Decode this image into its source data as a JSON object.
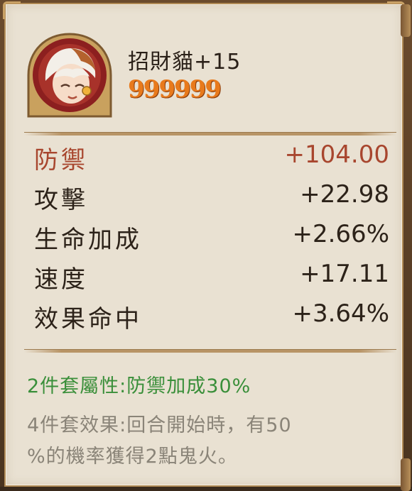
{
  "item": {
    "name": "招財貓+15",
    "level_glyphs": "999999"
  },
  "stats": {
    "main": {
      "name": "防禦",
      "value": "+104.00"
    },
    "subs": [
      {
        "name": "攻擊",
        "value": "+22.98"
      },
      {
        "name": "生命加成",
        "value": "+2.66%"
      },
      {
        "name": "速度",
        "value": "+17.11"
      },
      {
        "name": "效果命中",
        "value": "+3.64%"
      }
    ]
  },
  "set": {
    "two_piece": "2件套屬性:防禦加成30%",
    "four_piece_line1": "4件套效果:回合開始時，有50",
    "four_piece_line2": "%的機率獲得2點鬼火。"
  },
  "colors": {
    "main_stat": "#a8462e",
    "set_bonus": "#3a8f3a",
    "set_effect": "#8a8478",
    "level": "#e87a1c"
  }
}
